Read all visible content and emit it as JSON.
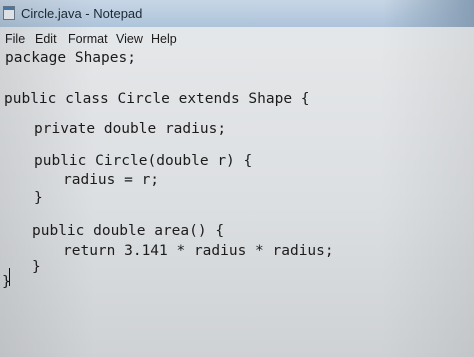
{
  "window": {
    "title": "Circle.java - Notepad"
  },
  "menu": {
    "items": [
      {
        "label": "File"
      },
      {
        "label": "Edit"
      },
      {
        "label": "Format"
      },
      {
        "label": "View"
      },
      {
        "label": "Help"
      }
    ]
  },
  "editor": {
    "lines": [
      "package Shapes;",
      "public class Circle extends Shape {",
      "private double radius;",
      "public Circle(double r) {",
      "radius = r;",
      "}",
      "public double area() {",
      "return 3.141 * radius * radius;",
      "}",
      "}"
    ]
  }
}
